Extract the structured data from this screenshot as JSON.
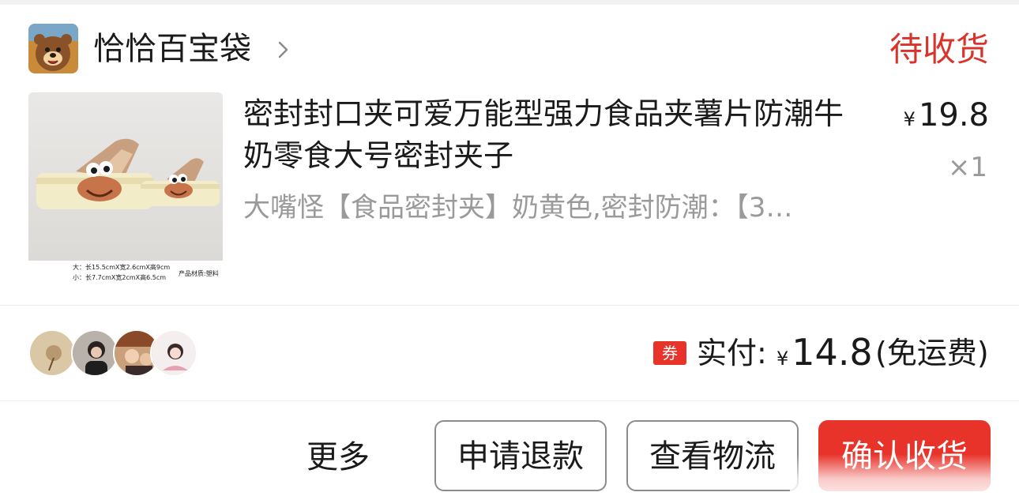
{
  "shop": {
    "name": "恰恰百宝袋",
    "avatar_icon": "bear-cartoon-avatar",
    "chevron_icon": "chevron-right-icon"
  },
  "order": {
    "status": "待收货",
    "status_color": "#d9342b"
  },
  "product": {
    "title": "密封封口夹可爱万能型强力食品夹薯片防潮牛奶零食大号密封夹子",
    "sku": "大嘴怪【食品密封夹】奶黄色,密封防潮：【3…",
    "price_symbol": "¥",
    "price": "19.8",
    "quantity": "×1",
    "image_caption": {
      "line1": "大：长15.5cmX宽2.6cmX高9cm",
      "line2": "小：长7.7cmX宽2cmX高6.5cm",
      "material": "产品材质:塑料"
    }
  },
  "buyers": {
    "avatar_icons": [
      "buyer-avatar-1",
      "buyer-avatar-2",
      "buyer-avatar-3",
      "buyer-avatar-4"
    ]
  },
  "payment": {
    "coupon_badge": "券",
    "label": "实付:",
    "currency": "¥",
    "amount": "14.8",
    "note": "(免运费)"
  },
  "actions": {
    "more": "更多",
    "refund": "申请退款",
    "logistics": "查看物流",
    "confirm": "确认收货"
  },
  "colors": {
    "accent": "#e8332a",
    "muted_text": "#9a9a9a"
  }
}
